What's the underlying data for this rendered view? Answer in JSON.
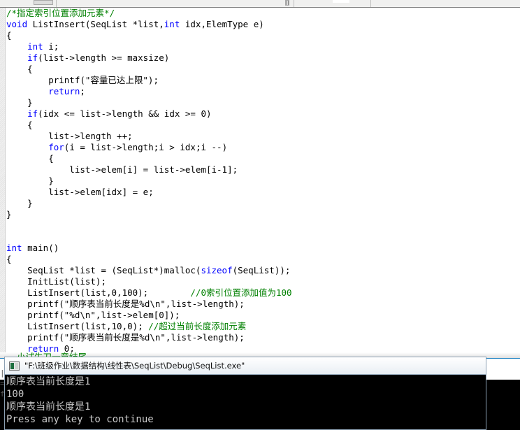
{
  "window": {
    "app": "visual-c-ide",
    "toolbar": {
      "visible_strip": true
    }
  },
  "editor": {
    "language": "c",
    "colors": {
      "keyword": "#0000ff",
      "comment": "#008000",
      "plain": "#000000",
      "background": "#ffffff",
      "gutter": "#e9e9e9"
    },
    "lines": [
      {
        "tokens": [
          {
            "t": "/*指定索引位置添加元素*/",
            "c": "cm"
          }
        ]
      },
      {
        "tokens": [
          {
            "t": "void",
            "c": "kw"
          },
          {
            "t": " ListInsert(SeqList *list,",
            "c": "pl"
          },
          {
            "t": "int",
            "c": "kw"
          },
          {
            "t": " idx,ElemType e)",
            "c": "pl"
          }
        ]
      },
      {
        "tokens": [
          {
            "t": "{",
            "c": "pl"
          }
        ]
      },
      {
        "tokens": [
          {
            "t": "    ",
            "c": "pl"
          },
          {
            "t": "int",
            "c": "kw"
          },
          {
            "t": " i;",
            "c": "pl"
          }
        ]
      },
      {
        "tokens": [
          {
            "t": "    ",
            "c": "pl"
          },
          {
            "t": "if",
            "c": "kw"
          },
          {
            "t": "(list->length >= maxsize)",
            "c": "pl"
          }
        ]
      },
      {
        "tokens": [
          {
            "t": "    {",
            "c": "pl"
          }
        ]
      },
      {
        "tokens": [
          {
            "t": "        printf(\"容量已达上限\");",
            "c": "pl"
          }
        ]
      },
      {
        "tokens": [
          {
            "t": "        ",
            "c": "pl"
          },
          {
            "t": "return",
            "c": "kw"
          },
          {
            "t": ";",
            "c": "pl"
          }
        ]
      },
      {
        "tokens": [
          {
            "t": "    }",
            "c": "pl"
          }
        ]
      },
      {
        "tokens": [
          {
            "t": "    ",
            "c": "pl"
          },
          {
            "t": "if",
            "c": "kw"
          },
          {
            "t": "(idx <= list->length && idx >= 0)",
            "c": "pl"
          }
        ]
      },
      {
        "tokens": [
          {
            "t": "    {",
            "c": "pl"
          }
        ]
      },
      {
        "tokens": [
          {
            "t": "        list->length ++;",
            "c": "pl"
          }
        ]
      },
      {
        "tokens": [
          {
            "t": "        ",
            "c": "pl"
          },
          {
            "t": "for",
            "c": "kw"
          },
          {
            "t": "(i = list->length;i > idx;i --)",
            "c": "pl"
          }
        ]
      },
      {
        "tokens": [
          {
            "t": "        {",
            "c": "pl"
          }
        ]
      },
      {
        "tokens": [
          {
            "t": "            list->elem[i] = list->elem[i-1];",
            "c": "pl"
          }
        ]
      },
      {
        "tokens": [
          {
            "t": "        }",
            "c": "pl"
          }
        ]
      },
      {
        "tokens": [
          {
            "t": "        list->elem[idx] = e;",
            "c": "pl"
          }
        ]
      },
      {
        "tokens": [
          {
            "t": "    }",
            "c": "pl"
          }
        ]
      },
      {
        "tokens": [
          {
            "t": "}",
            "c": "pl"
          }
        ]
      },
      {
        "tokens": [
          {
            "t": "",
            "c": "pl"
          }
        ]
      },
      {
        "tokens": [
          {
            "t": "",
            "c": "pl"
          }
        ]
      },
      {
        "tokens": [
          {
            "t": "int",
            "c": "kw"
          },
          {
            "t": " main()",
            "c": "pl"
          }
        ]
      },
      {
        "tokens": [
          {
            "t": "{",
            "c": "pl"
          }
        ]
      },
      {
        "tokens": [
          {
            "t": "    SeqList *list = (SeqList*)malloc(",
            "c": "pl"
          },
          {
            "t": "sizeof",
            "c": "kw"
          },
          {
            "t": "(SeqList));",
            "c": "pl"
          }
        ]
      },
      {
        "tokens": [
          {
            "t": "    InitList(list);",
            "c": "pl"
          }
        ]
      },
      {
        "tokens": [
          {
            "t": "    ListInsert(list,0,100);        ",
            "c": "pl"
          },
          {
            "t": "//0索引位置添加值为100",
            "c": "cm"
          }
        ]
      },
      {
        "tokens": [
          {
            "t": "    printf(\"顺序表当前长度是%d\\n\",list->length);",
            "c": "pl"
          }
        ]
      },
      {
        "tokens": [
          {
            "t": "    printf(\"%d\\n\",list->elem[0]);",
            "c": "pl"
          }
        ]
      },
      {
        "tokens": [
          {
            "t": "    ListInsert(list,10,0); ",
            "c": "pl"
          },
          {
            "t": "//超过当前长度添加元素",
            "c": "cm"
          }
        ]
      },
      {
        "tokens": [
          {
            "t": "    printf(\"顺序表当前长度是%d\\n\",list->length);",
            "c": "pl"
          }
        ]
      },
      {
        "tokens": [
          {
            "t": "    ",
            "c": "pl"
          },
          {
            "t": "return",
            "c": "kw"
          },
          {
            "t": " 0;",
            "c": "pl"
          }
        ]
      },
      {
        "tokens": [
          {
            "t": "}",
            "c": "pl"
          }
        ]
      }
    ]
  },
  "ide_bottom": {
    "occluded_label": "小试牛刀一章结尾",
    "left_relics": "|\n=\nf"
  },
  "console": {
    "title": "\"F:\\班级作业\\数据结构\\线性表\\SeqList\\Debug\\SeqList.exe\"",
    "icon": "console-app-icon",
    "output": [
      "顺序表当前长度是1",
      "100",
      "顺序表当前长度是1",
      "Press any key to continue"
    ]
  }
}
